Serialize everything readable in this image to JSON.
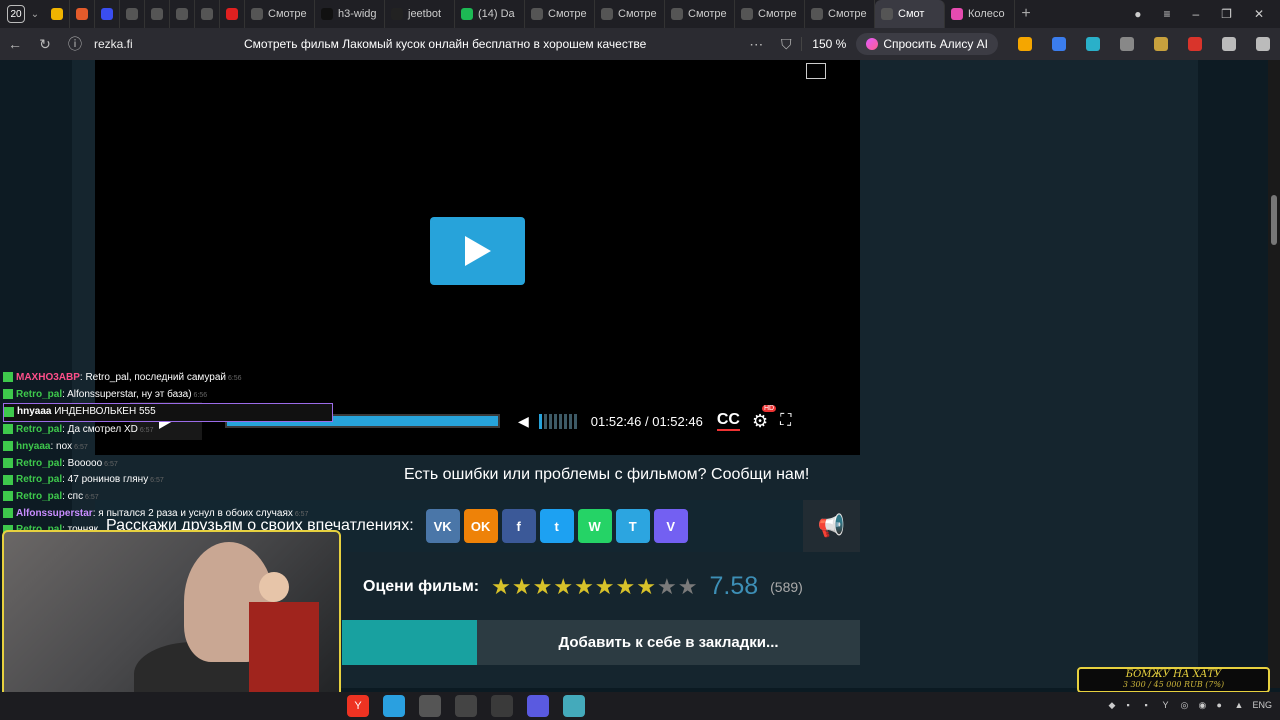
{
  "tabbar": {
    "tab_count": "20",
    "tabs": [
      {
        "label": "",
        "color": "#f0b400"
      },
      {
        "label": "",
        "color": "#e35b2b"
      },
      {
        "label": "",
        "color": "#3a4ef0"
      },
      {
        "label": "",
        "color": "#555"
      },
      {
        "label": "",
        "color": "#555"
      },
      {
        "label": "",
        "color": "#555"
      },
      {
        "label": "",
        "color": "#555"
      },
      {
        "label": "",
        "color": "#e02020"
      },
      {
        "label": "Смотре",
        "color": "#555"
      },
      {
        "label": "h3-widg",
        "color": "#111"
      },
      {
        "label": "jeetbot",
        "color": "#222"
      },
      {
        "label": "(14) Da",
        "color": "#1db954"
      },
      {
        "label": "Смотре",
        "color": "#555"
      },
      {
        "label": "Смотре",
        "color": "#555"
      },
      {
        "label": "Смотре",
        "color": "#555"
      },
      {
        "label": "Смотре",
        "color": "#555"
      },
      {
        "label": "Смотре",
        "color": "#555"
      },
      {
        "label": "Смот",
        "color": "#555"
      },
      {
        "label": "Колесо",
        "color": "#e64bb0"
      }
    ]
  },
  "addressbar": {
    "url": "rezka.fi",
    "title": "Смотреть фильм Лакомый кусок онлайн бесплатно в хорошем качестве",
    "zoom": "150 %",
    "alice": "Спросить Алису AI"
  },
  "player": {
    "time": "01:52:46 / 01:52:46",
    "cc": "CC",
    "hd": "HD",
    "progress": 1.0
  },
  "report": "Есть ошибки или проблемы с фильмом? Сообщи нам!",
  "share": {
    "label": "Расскажи друзьям о своих впечатлениях:",
    "networks": [
      {
        "label": "VK",
        "color": "#4a76a8"
      },
      {
        "label": "OK",
        "color": "#ee8208"
      },
      {
        "label": "f",
        "color": "#3b5998"
      },
      {
        "label": "t",
        "color": "#1da1f2"
      },
      {
        "label": "W",
        "color": "#25d366"
      },
      {
        "label": "T",
        "color": "#2ca5e0"
      },
      {
        "label": "V",
        "color": "#7360f2"
      }
    ]
  },
  "rating": {
    "label": "Оцени фильм:",
    "value": "7.58",
    "count": "(589)",
    "stars_filled": 7.58,
    "stars_total": 10
  },
  "bookmark": {
    "label": "Добавить к себе в закладки..."
  },
  "chat": [
    {
      "user": "MAXHO3ABP",
      "color": "#ff4f8a",
      "text": ": Retro_pal, последний самурай",
      "time": "6:56"
    },
    {
      "user": "Retro_pal",
      "color": "#3ec94c",
      "text": ": Alfonssuperstar, ну эт база)",
      "time": "6:56"
    },
    {
      "user": "hnyaaa",
      "color": "#ffffff",
      "text": "  ИНДЕНВОЛЬКЕН  555",
      "time": "",
      "highlight": true
    },
    {
      "user": "Retro_pal",
      "color": "#3ec94c",
      "text": ": Да смотрел XD",
      "time": "6:57"
    },
    {
      "user": "hnyaaa",
      "color": "#3ec94c",
      "text": ": nox",
      "time": "6:57"
    },
    {
      "user": "Retro_pal",
      "color": "#3ec94c",
      "text": ": Booooo",
      "time": "6:57"
    },
    {
      "user": "Retro_pal",
      "color": "#3ec94c",
      "text": ": 47 ронинов гляну",
      "time": "6:57"
    },
    {
      "user": "Retro_pal",
      "color": "#3ec94c",
      "text": ": спс",
      "time": "6:57"
    },
    {
      "user": "Alfonssuperstar",
      "color": "#c98dff",
      "text": ": я пытался 2 раза и уснул в обоих случаях",
      "time": "6:57"
    },
    {
      "user": "Retro_pal",
      "color": "#3ec94c",
      "text": ": точняк",
      "time": ""
    }
  ],
  "donate": {
    "title": "БОМЖУ НА ХАТУ",
    "sub": "3 300 / 45 000 RUB (7%)"
  },
  "taskbar": {
    "icons": [
      {
        "label": "Y",
        "color": "#e32"
      },
      {
        "label": "",
        "color": "#2aa0e0"
      },
      {
        "label": "",
        "color": "#555"
      },
      {
        "label": "",
        "color": "#444"
      },
      {
        "label": "",
        "color": "#3a3a3a"
      },
      {
        "label": "",
        "color": "#5a5ae0"
      },
      {
        "label": "",
        "color": "#4ab"
      }
    ],
    "tray_lang": "ENG"
  }
}
